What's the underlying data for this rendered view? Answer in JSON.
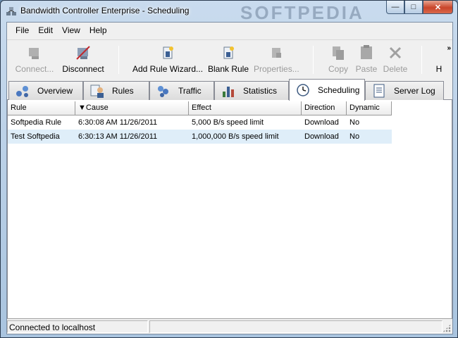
{
  "window": {
    "title": "Bandwidth Controller Enterprise - Scheduling",
    "watermark": "SOFTPEDIA"
  },
  "menu": {
    "file": "File",
    "edit": "Edit",
    "view": "View",
    "help": "Help"
  },
  "toolbar": {
    "connect": "Connect...",
    "disconnect": "Disconnect",
    "add_rule_wizard": "Add Rule Wizard...",
    "blank_rule": "Blank Rule",
    "properties": "Properties...",
    "copy": "Copy",
    "paste": "Paste",
    "delete": "Delete",
    "help": "H",
    "overflow": "»"
  },
  "tabs": [
    {
      "label": "Overview",
      "icon": "network-icon"
    },
    {
      "label": "Rules",
      "icon": "user-rules-icon"
    },
    {
      "label": "Traffic",
      "icon": "traffic-icon"
    },
    {
      "label": "Statistics",
      "icon": "bar-chart-icon"
    },
    {
      "label": "Scheduling",
      "icon": "clock-icon",
      "active": true
    },
    {
      "label": "Server Log",
      "icon": "document-icon"
    }
  ],
  "table": {
    "columns": [
      "Rule",
      "▼Cause",
      "Effect",
      "Direction",
      "Dynamic"
    ],
    "rows": [
      [
        "Softpedia Rule",
        "6:30:08 AM 11/26/2011",
        "5,000 B/s speed limit",
        "Download",
        "No"
      ],
      [
        "Test Softpedia",
        "6:30:13 AM 11/26/2011",
        "1,000,000 B/s speed limit",
        "Download",
        "No"
      ]
    ]
  },
  "status": {
    "connection": "Connected to localhost",
    "pane2": ""
  },
  "colors": {
    "selected_row": "#dfeef9",
    "close_button": "#c9452a"
  }
}
